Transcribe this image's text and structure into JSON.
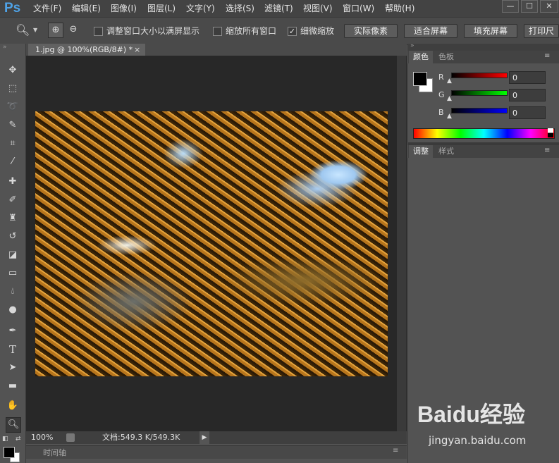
{
  "app": {
    "logo": "Ps"
  },
  "menu": [
    "文件(F)",
    "编辑(E)",
    "图像(I)",
    "图层(L)",
    "文字(Y)",
    "选择(S)",
    "滤镜(T)",
    "视图(V)",
    "窗口(W)",
    "帮助(H)"
  ],
  "window_controls": [
    "—",
    "☐",
    "✕"
  ],
  "options": {
    "checkbox1_label": "调整窗口大小以满屏显示",
    "checkbox2_label": "缩放所有窗口",
    "checkbox3_label": "细微缩放",
    "checkbox1_checked": false,
    "checkbox2_checked": false,
    "checkbox3_checked": true,
    "btn_actual": "实际像素",
    "btn_fit": "适合屏幕",
    "btn_fill": "填充屏幕",
    "btn_print": "打印尺"
  },
  "document": {
    "tab_label": "1.jpg @ 100%(RGB/8#) *",
    "tab_close": "×"
  },
  "status": {
    "zoom": "100%",
    "doc_info": "文档:549.3 K/549.3K"
  },
  "timeline": {
    "label": "时间轴"
  },
  "color_panel": {
    "tabs": [
      "颜色",
      "色板"
    ],
    "r_label": "R",
    "g_label": "G",
    "b_label": "B",
    "r_value": "0",
    "g_value": "0",
    "b_value": "0"
  },
  "adjust_panel": {
    "tabs": [
      "调整",
      "样式"
    ]
  },
  "watermark": {
    "brand": "Baidu经验",
    "url": "jingyan.baidu.com"
  }
}
